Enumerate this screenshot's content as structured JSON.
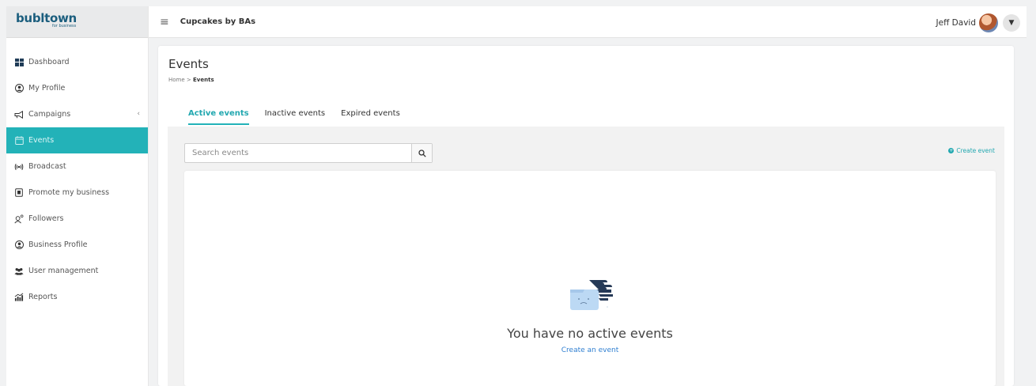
{
  "logo": {
    "text": "bubltown",
    "sub": "for business"
  },
  "header": {
    "brand": "Cupcakes by BAs",
    "user_name": "Jeff David"
  },
  "sidebar": {
    "items": [
      {
        "label": "Dashboard",
        "icon": "dashboard-icon"
      },
      {
        "label": "My Profile",
        "icon": "profile-icon"
      },
      {
        "label": "Campaigns",
        "icon": "megaphone-icon",
        "expandable": true
      },
      {
        "label": "Events",
        "icon": "calendar-icon",
        "active": true
      },
      {
        "label": "Broadcast",
        "icon": "broadcast-icon"
      },
      {
        "label": "Promote my business",
        "icon": "promote-icon"
      },
      {
        "label": "Followers",
        "icon": "followers-icon"
      },
      {
        "label": "Business Profile",
        "icon": "business-profile-icon"
      },
      {
        "label": "User management",
        "icon": "users-icon"
      },
      {
        "label": "Reports",
        "icon": "reports-icon"
      }
    ],
    "campaigns_chevron": "‹"
  },
  "page": {
    "title": "Events",
    "breadcrumb": {
      "home": "Home",
      "separator": ">",
      "current": "Events"
    }
  },
  "tabs": [
    {
      "label": "Active events",
      "active": true
    },
    {
      "label": "Inactive events"
    },
    {
      "label": "Expired events"
    }
  ],
  "search": {
    "placeholder": "Search events",
    "value": ""
  },
  "actions": {
    "create_event": "Create event"
  },
  "empty_state": {
    "title": "You have no active events",
    "link": "Create an event"
  },
  "colors": {
    "accent": "#23b2b8",
    "link": "#2f7fd1",
    "logo": "#1b5e7e"
  }
}
